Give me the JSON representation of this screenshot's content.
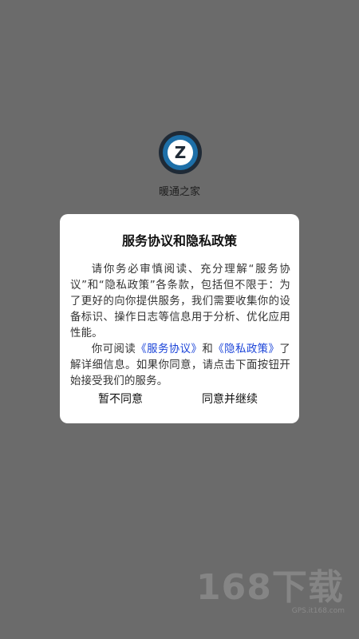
{
  "app": {
    "name": "暖通之家"
  },
  "dialog": {
    "title": "服务协议和隐私政策",
    "para1": "请你务必审慎阅读、充分理解“服务协议”和“隐私政策”各条款，包括但不限于：为了更好的向你提供服务，我们需要收集你的设备标识、操作日志等信息用于分析、优化应用性能。",
    "para2_prefix": "你可阅读",
    "link_service": "《服务协议》",
    "para2_and": "和",
    "link_privacy": "《隐私政策》",
    "para2_suffix": "了解详细信息。如果你同意，请点击下面按钮开始接受我们的服务。",
    "decline_label": "暂不同意",
    "accept_label": "同意并继续"
  },
  "watermark": {
    "main": "168下载",
    "sub": "GPS.it168.com"
  },
  "colors": {
    "overlay": "#6b6b6b",
    "link": "#1a43d8",
    "logo_blue": "#1d6fa8"
  }
}
